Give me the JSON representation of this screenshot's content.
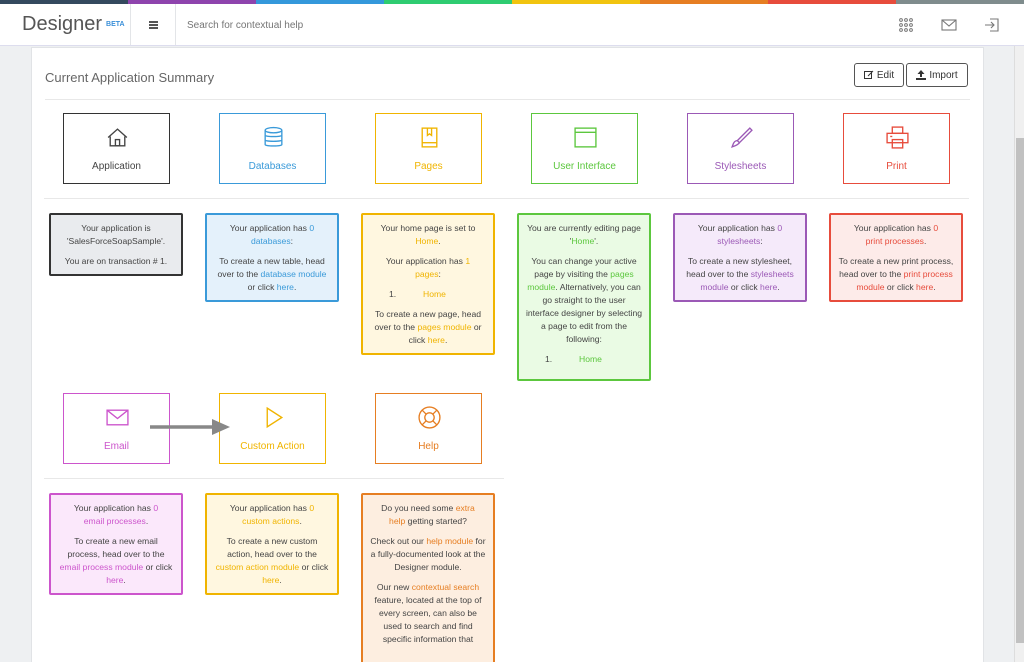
{
  "colors": {
    "stripe": [
      "#34495e",
      "#8e44ad",
      "#3498db",
      "#2ecc71",
      "#f1c40f",
      "#e67e22",
      "#e74c3c",
      "#7f8c8d"
    ],
    "application": "#333333",
    "databases": "#3a9ad9",
    "pages": "#f0b400",
    "ui": "#5cc73e",
    "stylesheets": "#9b59b6",
    "print": "#e74c3c",
    "email": "#cc55cc",
    "custom_action": "#f0b400",
    "help": "#e67e22"
  },
  "header": {
    "brand": "Designer",
    "beta": "BETA",
    "search_placeholder": "Search for contextual help",
    "icons": [
      "grid-icon",
      "mail-icon",
      "sign-out-icon"
    ]
  },
  "panel": {
    "title": "Current Application Summary",
    "edit_label": "Edit",
    "import_label": "Import"
  },
  "modules": {
    "application": {
      "label": "Application"
    },
    "databases": {
      "label": "Databases"
    },
    "pages": {
      "label": "Pages"
    },
    "ui": {
      "label": "User Interface"
    },
    "stylesheets": {
      "label": "Stylesheets"
    },
    "print": {
      "label": "Print"
    },
    "email": {
      "label": "Email"
    },
    "custom_action": {
      "label": "Custom Action"
    },
    "help": {
      "label": "Help"
    }
  },
  "info": {
    "application": {
      "l1": "Your application is",
      "l2": "'SalesForceSoapSample'.",
      "l3": "You are on transaction # 1."
    },
    "databases": {
      "a": "Your application has ",
      "count": "0",
      "b": "databases",
      "c": ":",
      "d": "To create a new table, head over to the ",
      "link": "database module",
      "e": " or click ",
      "here": "here",
      "f": "."
    },
    "pages": {
      "a": "Your home page is set to",
      "home": "Home",
      "dot": ".",
      "b": "Your application has ",
      "count": "1",
      "c": "pages",
      "colon": ":",
      "item_num": "1.",
      "item_val": "Home",
      "d": "To create a new page, head over to the ",
      "link": "pages module",
      "e": " or click ",
      "here": "here",
      "f": "."
    },
    "ui": {
      "a": "You are currently editing page '",
      "page": "Home",
      "b": "'.",
      "c": "You can change your active page by visiting the ",
      "link": "pages module",
      "d": ". Alternatively, you can go straight to the user interface designer by selecting a page to edit from the following:",
      "item_num": "1.",
      "item_val": "Home"
    },
    "stylesheets": {
      "a": "Your application has ",
      "count": "0",
      "b": "stylesheets",
      "c": ":",
      "d": "To create a new stylesheet, head over to the ",
      "link": "stylesheets module",
      "e": " or click ",
      "here": "here",
      "f": "."
    },
    "print": {
      "a": "Your application has ",
      "count": "0",
      "b": "print processes",
      "c": ".",
      "d": "To create a new print process, head over to the ",
      "link": "print process module",
      "e": " or click ",
      "here": "here",
      "f": "."
    },
    "email": {
      "a": "Your application has ",
      "count": "0",
      "b": "email processes",
      "c": ".",
      "d": "To create a new email process, head over to the ",
      "link": "email process module",
      "e": " or click ",
      "here": "here",
      "f": "."
    },
    "custom_action": {
      "a": "Your application has ",
      "count": "0",
      "b": "custom actions",
      "c": ".",
      "d": "To create a new custom action, head over to the ",
      "link": "custom action module",
      "e": " or click ",
      "here": "here",
      "f": "."
    },
    "help": {
      "a": "Do you need some ",
      "extra": "extra",
      "help": "help",
      "b": " getting started?",
      "c": "Check out our ",
      "link": "help module",
      "d": " for a fully-documented look at the Designer module.",
      "e": "Our new ",
      "link2": "contextual search",
      "f": " feature, located at the top of every screen, can also be used to search and find specific information that"
    }
  }
}
